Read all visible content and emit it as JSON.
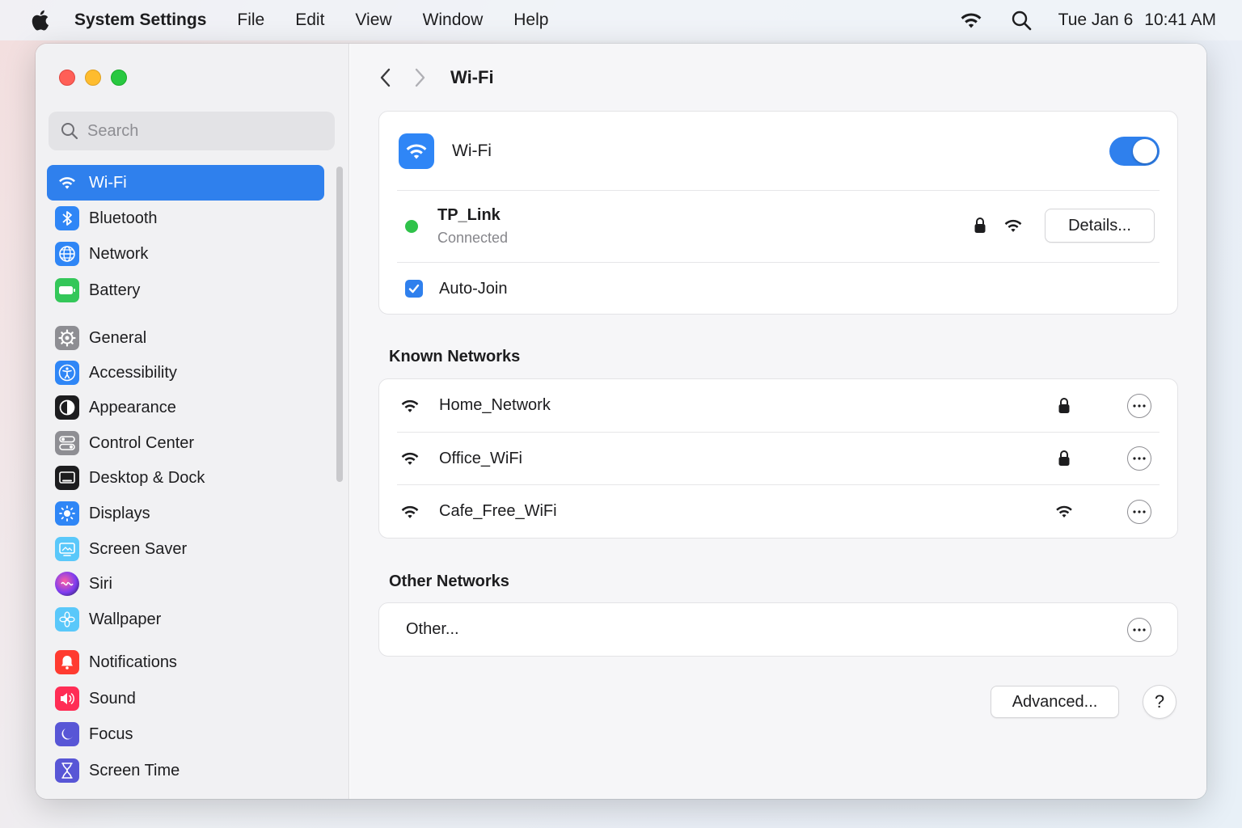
{
  "menubar": {
    "app_name": "System Settings",
    "menus": [
      "File",
      "Edit",
      "View",
      "Window",
      "Help"
    ],
    "date": "Tue Jan 6",
    "time": "10:41 AM"
  },
  "sidebar": {
    "search_placeholder": "Search",
    "items": [
      {
        "label": "Wi-Fi",
        "icon": "wifi-icon",
        "color": "#2f80ed"
      },
      {
        "label": "Bluetooth",
        "icon": "bluetooth-icon",
        "color": "#2f86f6"
      },
      {
        "label": "Network",
        "icon": "globe-icon",
        "color": "#2f86f6"
      },
      {
        "label": "Battery",
        "icon": "battery-icon",
        "color": "#34c759"
      },
      {
        "label": "General",
        "icon": "gear-icon",
        "color": "#8e8e93"
      },
      {
        "label": "Accessibility",
        "icon": "accessibility-icon",
        "color": "#2f86f6"
      },
      {
        "label": "Appearance",
        "icon": "appearance-icon",
        "color": "#1d1d1f"
      },
      {
        "label": "Control Center",
        "icon": "control-center-icon",
        "color": "#8e8e93"
      },
      {
        "label": "Desktop & Dock",
        "icon": "desktop-dock-icon",
        "color": "#1d1d1f"
      },
      {
        "label": "Displays",
        "icon": "displays-icon",
        "color": "#2f86f6"
      },
      {
        "label": "Screen Saver",
        "icon": "screen-saver-icon",
        "color": "#5ac8fa"
      },
      {
        "label": "Siri",
        "icon": "siri-icon",
        "color": "#5e3ea1"
      },
      {
        "label": "Wallpaper",
        "icon": "wallpaper-icon",
        "color": "#5ac8fa"
      },
      {
        "label": "Notifications",
        "icon": "bell-icon",
        "color": "#ff3b30"
      },
      {
        "label": "Sound",
        "icon": "speaker-icon",
        "color": "#ff2d55"
      },
      {
        "label": "Focus",
        "icon": "moon-icon",
        "color": "#5856d6"
      },
      {
        "label": "Screen Time",
        "icon": "hourglass-icon",
        "color": "#5856d6"
      }
    ]
  },
  "main": {
    "title": "Wi-Fi",
    "wifi_card": {
      "label": "Wi-Fi",
      "enabled": true,
      "current_network": "TP_Link",
      "current_status": "Connected",
      "details_button": "Details...",
      "auto_join_label": "Auto-Join",
      "auto_join_checked": true
    },
    "known_networks_title": "Known Networks",
    "known_networks": [
      {
        "name": "Home_Network",
        "status_icon": "lock-icon"
      },
      {
        "name": "Office_WiFi",
        "status_icon": "lock-icon"
      },
      {
        "name": "Cafe_Free_WiFi",
        "status_icon": "wifi-icon"
      }
    ],
    "other_networks_title": "Other Networks",
    "other_label": "Other...",
    "advanced_button": "Advanced...",
    "help_button": "?"
  },
  "colors": {
    "accent": "#2f80ed",
    "connected_dot": "#2fc24a"
  }
}
